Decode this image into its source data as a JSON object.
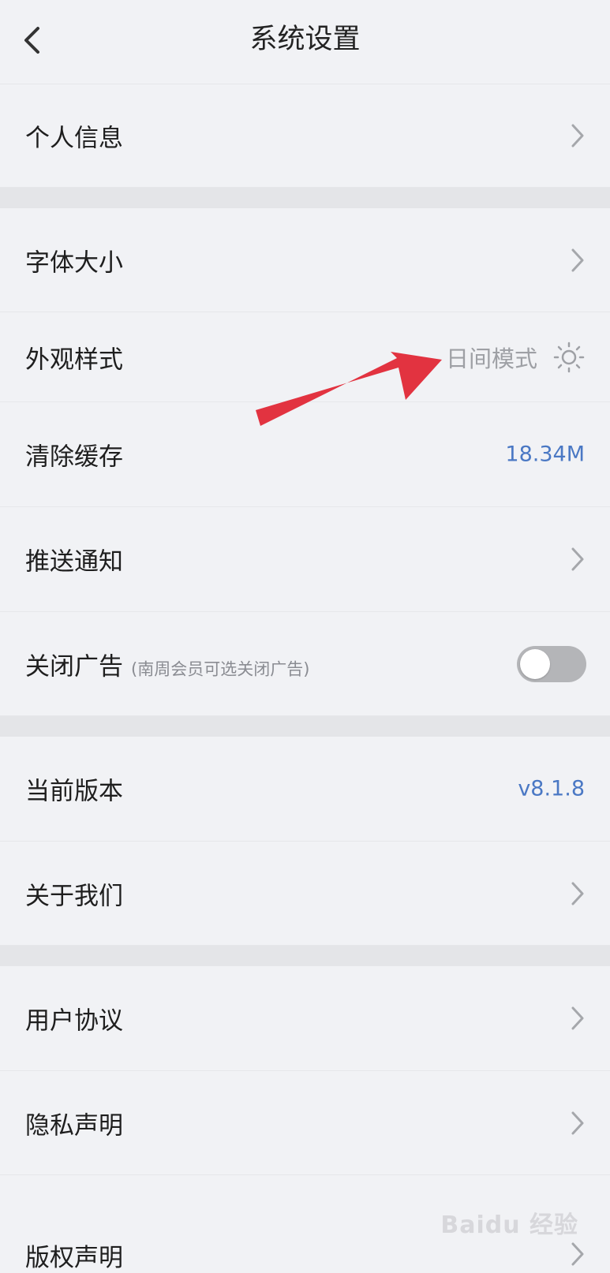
{
  "header": {
    "title": "系统设置"
  },
  "rows": {
    "personal_info": "个人信息",
    "font_size": "字体大小",
    "appearance": {
      "label": "外观样式",
      "value": "日间模式"
    },
    "clear_cache": {
      "label": "清除缓存",
      "value": "18.34M"
    },
    "push": "推送通知",
    "close_ads": {
      "label": "关闭广告",
      "note": "(南周会员可选关闭广告)",
      "toggle_on": false
    },
    "version": {
      "label": "当前版本",
      "value": "v8.1.8"
    },
    "about": "关于我们",
    "user_agreement": "用户协议",
    "privacy": "隐私声明",
    "copyright": "版权声明"
  },
  "watermark": "Baidu 经验",
  "colors": {
    "accent_blue": "#4a78c4",
    "arrow": "#e23340",
    "background": "#f1f2f5",
    "divider": "#e4e5e8"
  },
  "icons": [
    "back-chevron-icon",
    "chevron-right-icon",
    "sun-icon",
    "red-arrow-annotation"
  ]
}
